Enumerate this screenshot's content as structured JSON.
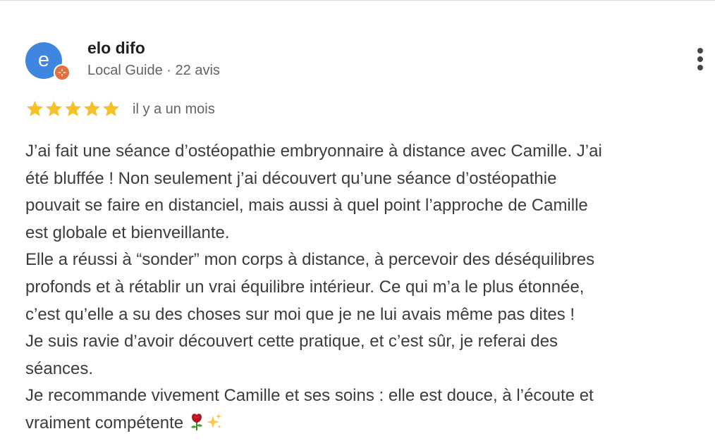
{
  "reviewer": {
    "name": "elo difo",
    "avatar_initial": "e",
    "meta": "Local Guide · 22 avis"
  },
  "review": {
    "rating": 5,
    "max_rating": 5,
    "date": "il y a un mois",
    "lines": [
      "J’ai fait une séance d’ostéopathie embryonnaire à distance avec Camille. J’ai",
      "été bluffée ! Non seulement j’ai découvert qu’une séance d’ostéopathie",
      "pouvait se faire en distanciel, mais aussi à quel point l’approche de Camille",
      "est globale et bienveillante.",
      "Elle a réussi à “sonder” mon corps à distance, à percevoir des déséquilibres",
      "profonds et à rétablir un vrai équilibre intérieur. Ce qui m’a le plus étonnée,",
      "c’est qu’elle a su des choses sur moi que je ne lui avais même pas dites !",
      "Je suis ravie d’avoir découvert cette pratique, et c’est sûr, je referai des",
      "séances.",
      "Je recommande vivement Camille et ses soins : elle est douce, à l’écoute et",
      "vraiment compétente"
    ],
    "trailing_emoji": [
      "rose-icon",
      "sparkles-icon"
    ]
  },
  "colors": {
    "avatar": "#3f86e0",
    "badge": "#e2703d",
    "star": "#f5c127",
    "text": "#3c3c3c",
    "muted": "#5f6368"
  }
}
